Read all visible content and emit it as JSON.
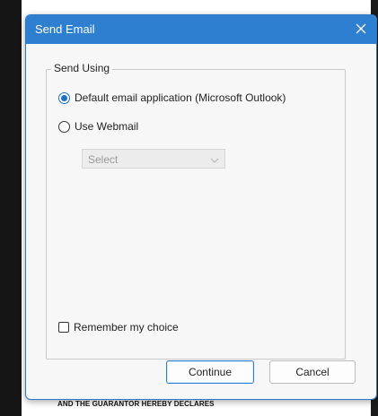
{
  "dialog": {
    "title": "Send Email",
    "group_label": "Send Using",
    "options": [
      {
        "label": "Default email application (Microsoft Outlook)",
        "selected": true
      },
      {
        "label": "Use Webmail",
        "selected": false
      }
    ],
    "webmail_select": {
      "value": "Select",
      "disabled": true
    },
    "remember_label": "Remember my choice",
    "remember_checked": false,
    "continue_label": "Continue",
    "cancel_label": "Cancel"
  },
  "background_document": {
    "visible_text": "AND THE GUARANTOR HEREBY DECLARES"
  },
  "colors": {
    "titlebar": "#2f7fd0",
    "accent": "#1f6fc5",
    "dialog_bg": "#f7f7f7"
  },
  "icons": [
    "close-icon",
    "chevron-down-icon"
  ]
}
